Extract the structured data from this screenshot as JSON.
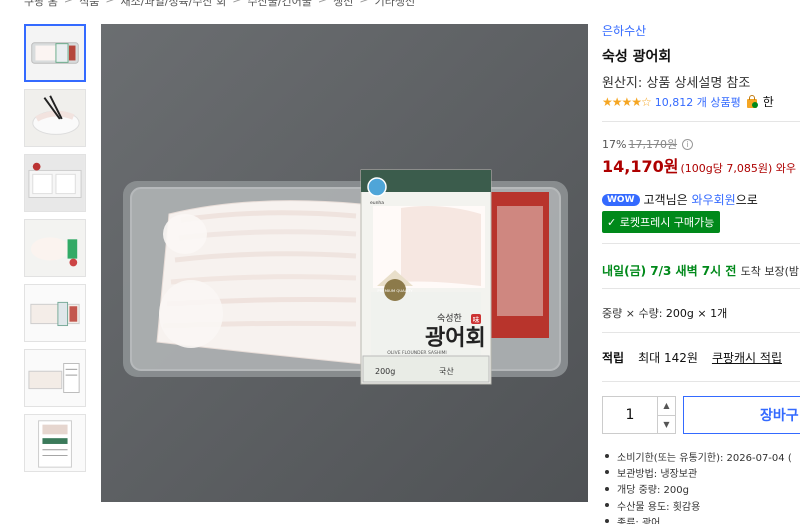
{
  "breadcrumb": [
    "쿠팡 홈",
    "식품",
    "채소/과일/정육/수산 회",
    "수산물/건어물",
    "생선",
    "기타생선"
  ],
  "thumbnails": [
    "thumb-1",
    "thumb-2",
    "thumb-3",
    "thumb-4",
    "thumb-5",
    "thumb-6",
    "thumb-7"
  ],
  "product": {
    "brand": "은하수산",
    "title": "숙성 광어회",
    "origin": "원산지: 상품 상세설명 참조",
    "rating_stars": "★★★★☆",
    "review_count": "10,812 개 상품평",
    "rating_extra": "한"
  },
  "price": {
    "discount": "17%",
    "original": "17,170원",
    "current": "14,170원",
    "unit": "(100g당 7,085원) 와우"
  },
  "wow": {
    "badge": "WOW",
    "prefix": "고객님은",
    "member": "와우회원",
    "suffix": "으로"
  },
  "rocket": {
    "label": "✓ 로켓프레시 구매가능"
  },
  "delivery": {
    "main": "내일(금) 7/3 새벽 7시 전",
    "tail": "도착 보장(밤"
  },
  "option": {
    "label": "중량 × 수량:",
    "value": "200g × 1개"
  },
  "points": {
    "label": "적립",
    "text": "최대 142원",
    "link": "쿠팡캐시 적립"
  },
  "quantity": {
    "value": "1",
    "up": "▲",
    "down": "▼"
  },
  "cart_button": {
    "label": "장바구"
  },
  "details": [
    "소비기한(또는 유통기한): 2026-07-04 (",
    "보관방법: 냉장보관",
    "개당 중량: 200g",
    "수산물 용도: 횟감용",
    "종류: 광어"
  ],
  "package": {
    "brand_text": "eunha",
    "premium": "PREMIUM QUALITY",
    "small": "숙성한",
    "flag": "味",
    "name": "광어회",
    "english": "OLIVE FLOUNDER SASHIMI",
    "weight": "200g",
    "origin_mark": "국산"
  },
  "colors": {
    "accent": "#346aff",
    "price": "#ae0000",
    "rocket": "#00891a",
    "star": "#f5a623"
  }
}
